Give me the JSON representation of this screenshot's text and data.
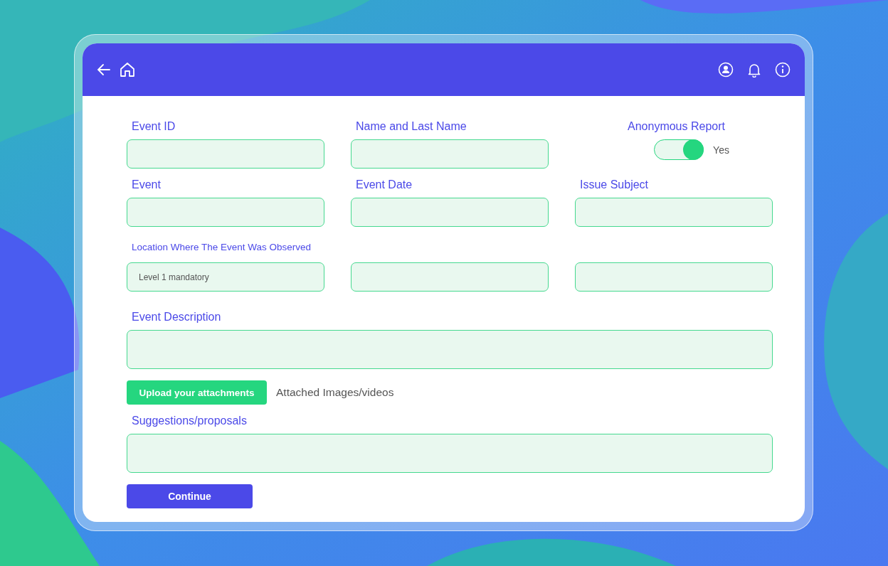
{
  "fields": [
    {
      "kind": "text",
      "label": "Event ID"
    },
    {
      "kind": "text",
      "label": "Name and Last Name"
    },
    {
      "kind": "toggle",
      "label": "Anonymous Report",
      "on": true,
      "value": "Yes"
    },
    {
      "kind": "text",
      "label": "Event"
    },
    {
      "kind": "text",
      "label": "Event Date"
    },
    {
      "kind": "text",
      "label": "Issue Subject"
    },
    {
      "kind": "level",
      "label": "Location Where The Event Was Observed",
      "placeholder": "Level 1 mandatory"
    },
    {
      "kind": "level"
    },
    {
      "kind": "level"
    }
  ],
  "description": {
    "label": "Event Description"
  },
  "attachments": {
    "button": "Upload your attachments",
    "note": "Attached Images/videos"
  },
  "suggestions": {
    "label": "Suggestions/proposals"
  },
  "continue": "Continue"
}
